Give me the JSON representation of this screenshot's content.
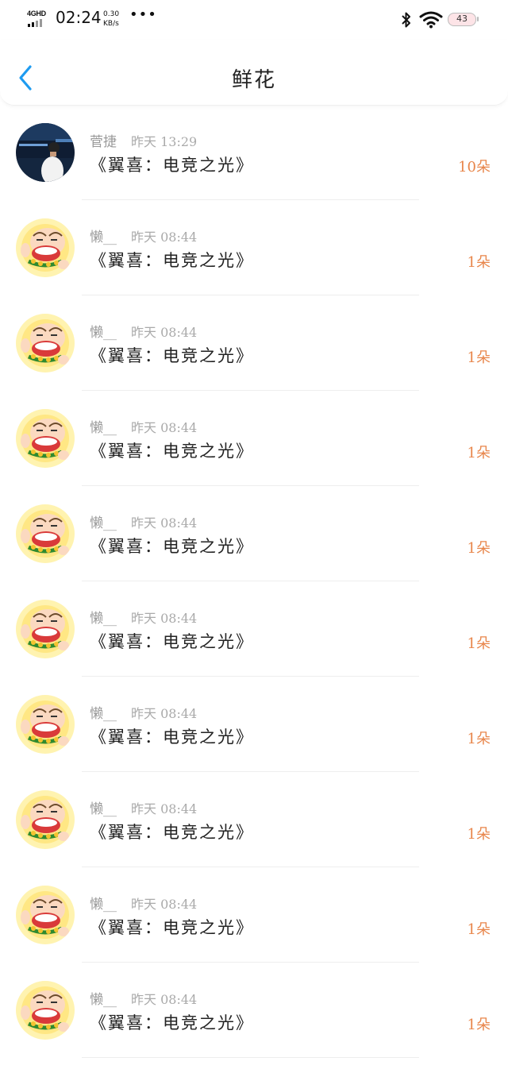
{
  "status_bar": {
    "network": "4GHD",
    "time": "02:24",
    "speed_value": "0.30",
    "speed_unit": "KB/s",
    "more": "•••",
    "battery": "43"
  },
  "header": {
    "back_icon": "chevron-left-icon",
    "title": "鲜花"
  },
  "colors": {
    "accent": "#1e9bf0",
    "count": "#e8864b"
  },
  "items": [
    {
      "user": "菅捷",
      "time": "昨天 13:29",
      "title": "《翼喜：电竞之光》",
      "count": "10朵",
      "avatar": "photo"
    },
    {
      "user": "懒__",
      "time": "昨天 08:44",
      "title": "《翼喜：电竞之光》",
      "count": "1朵",
      "avatar": "cartoon"
    },
    {
      "user": "懒__",
      "time": "昨天 08:44",
      "title": "《翼喜：电竞之光》",
      "count": "1朵",
      "avatar": "cartoon"
    },
    {
      "user": "懒__",
      "time": "昨天 08:44",
      "title": "《翼喜：电竞之光》",
      "count": "1朵",
      "avatar": "cartoon"
    },
    {
      "user": "懒__",
      "time": "昨天 08:44",
      "title": "《翼喜：电竞之光》",
      "count": "1朵",
      "avatar": "cartoon"
    },
    {
      "user": "懒__",
      "time": "昨天 08:44",
      "title": "《翼喜：电竞之光》",
      "count": "1朵",
      "avatar": "cartoon"
    },
    {
      "user": "懒__",
      "time": "昨天 08:44",
      "title": "《翼喜：电竞之光》",
      "count": "1朵",
      "avatar": "cartoon"
    },
    {
      "user": "懒__",
      "time": "昨天 08:44",
      "title": "《翼喜：电竞之光》",
      "count": "1朵",
      "avatar": "cartoon"
    },
    {
      "user": "懒__",
      "time": "昨天 08:44",
      "title": "《翼喜：电竞之光》",
      "count": "1朵",
      "avatar": "cartoon"
    },
    {
      "user": "懒__",
      "time": "昨天 08:44",
      "title": "《翼喜：电竞之光》",
      "count": "1朵",
      "avatar": "cartoon"
    }
  ]
}
